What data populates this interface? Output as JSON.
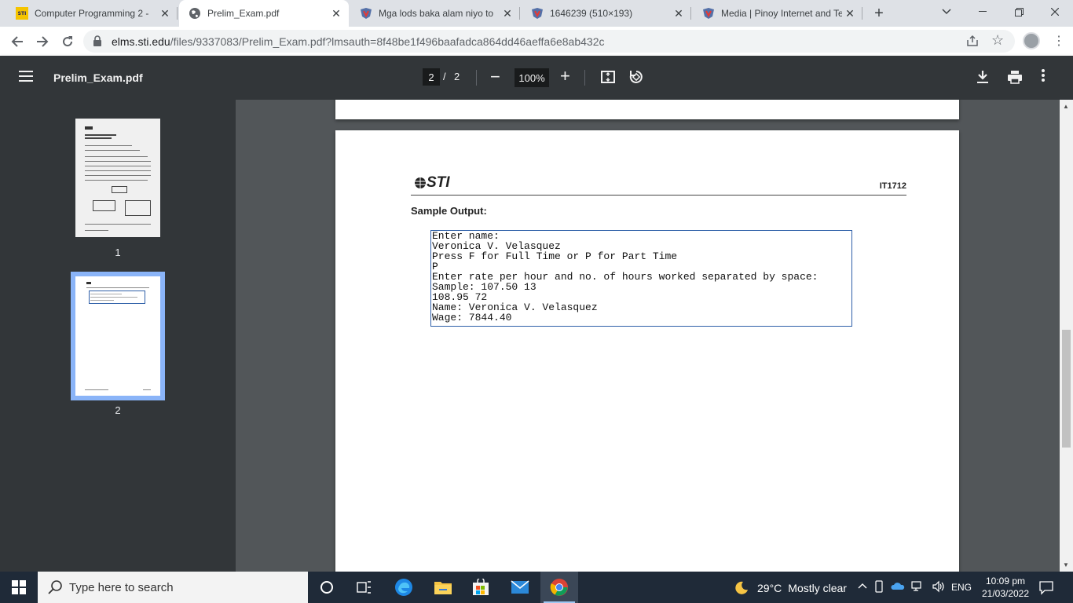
{
  "tabs": [
    {
      "title": "Computer Programming 2 - ",
      "favicon": "sti-icon",
      "active": false
    },
    {
      "title": "Prelim_Exam.pdf",
      "favicon": "globe-icon",
      "active": true
    },
    {
      "title": "Mga lods baka alam niyo to ",
      "favicon": "brainly-icon",
      "active": false
    },
    {
      "title": "1646239 (510×193)",
      "favicon": "brainly-icon",
      "active": false
    },
    {
      "title": "Media | Pinoy Internet and Te",
      "favicon": "brainly-icon",
      "active": false
    }
  ],
  "address": {
    "domain": "elms.sti.edu",
    "path": "/files/9337083/Prelim_Exam.pdf?lmsauth=8f48be1f496baafadca864dd46aeffa6e8ab432c"
  },
  "pdf_toolbar": {
    "title": "Prelim_Exam.pdf",
    "current_page": "2",
    "separator": "/",
    "total_pages": "2",
    "zoom": "100%"
  },
  "thumbnails": [
    {
      "label": "1"
    },
    {
      "label": "2"
    }
  ],
  "page": {
    "logo_text": "STI",
    "course_code": "IT1712",
    "heading": "Sample Output:",
    "output_lines": [
      "Enter name:",
      "Veronica V. Velasquez",
      "Press F for Full Time or P for Part Time",
      "P",
      "Enter rate per hour and no. of hours worked separated by space:",
      "Sample: 107.50 13",
      "108.95 72",
      "Name: Veronica V. Velasquez",
      "Wage: 7844.40"
    ]
  },
  "taskbar": {
    "search_placeholder": "Type here to search",
    "weather_temp": "29°C",
    "weather_text": "Mostly clear",
    "language": "ENG",
    "time": "10:09 pm",
    "date": "21/03/2022"
  }
}
